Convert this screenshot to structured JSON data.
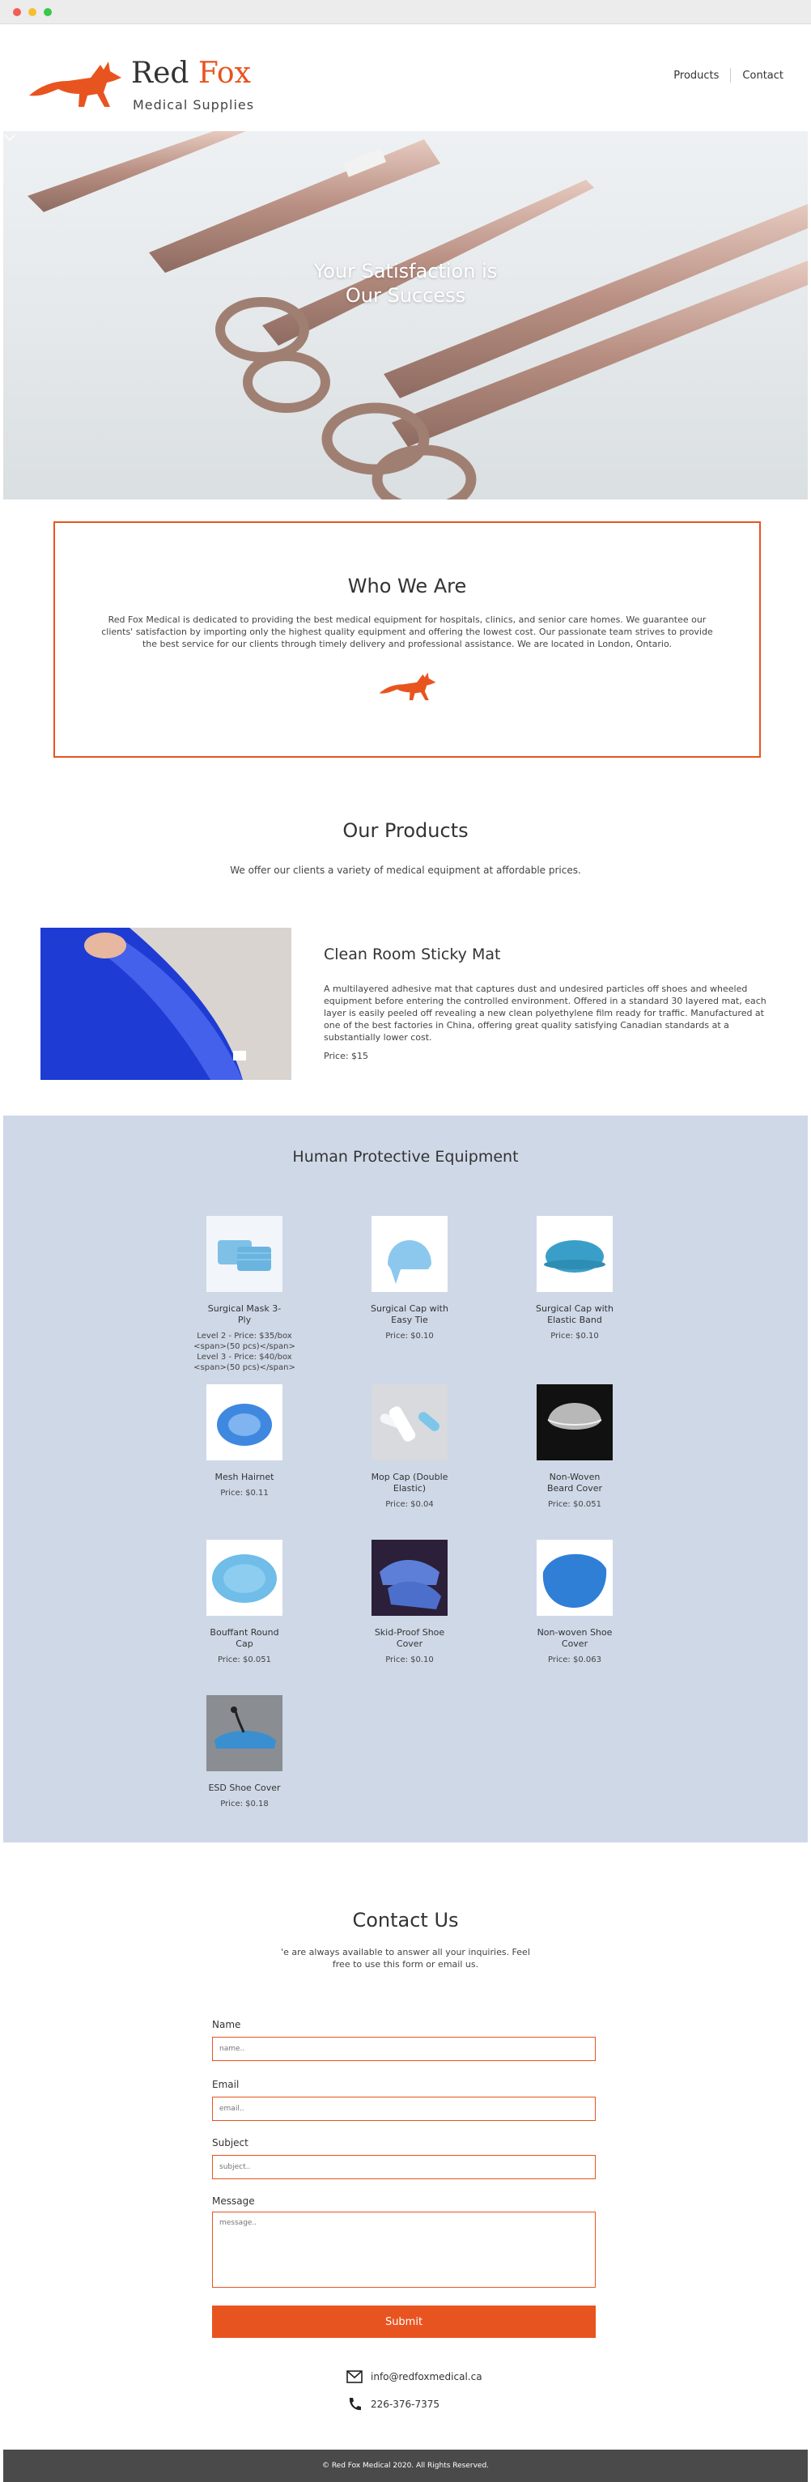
{
  "brand": {
    "name_part1": "Red",
    "name_part2": "Fox",
    "tagline": "Medical Supplies",
    "accent_color": "#e8541f"
  },
  "nav": {
    "items": [
      "Products",
      "Contact"
    ]
  },
  "hero": {
    "title_line1": "Your Satisfaction is",
    "title_line2": "Our Success",
    "icon": "chevron-down-icon"
  },
  "who": {
    "title": "Who We Are",
    "text": "Red Fox Medical is dedicated to providing the best medical equipment for hospitals, clinics, and senior care homes. We guarantee our clients' satisfaction by importing only the highest quality equipment and offering the lowest cost. Our passionate team strives to provide the best service for our clients through timely delivery and professional assistance. We are located in London, Ontario."
  },
  "products": {
    "title": "Our Products",
    "intro": "We offer our clients a variety of medical equipment at affordable prices.",
    "featured": {
      "name": "Clean Room Sticky Mat",
      "description": "A multilayered adhesive mat that captures dust and undesired particles off shoes and wheeled equipment before entering the controlled environment. Offered in a standard 30 layered mat, each layer is easily peeled off revealing a new clean polyethylene film ready for traffic. Manufactured at one of the best factories in China, offering great quality satisfying Canadian standards at a substantially lower cost.",
      "price": "Price: $15"
    }
  },
  "ppe": {
    "title": "Human Protective Equipment",
    "items": [
      {
        "name": "Surgical Mask 3-Ply",
        "price1": "Level 2 - Price: $35/box <span>(50 pcs)</span>",
        "price2": "Level 3 - Price: $40/box <span>(50 pcs)</span>"
      },
      {
        "name": "Surgical Cap with Easy Tie",
        "price1": "Price: $0.10",
        "price2": ""
      },
      {
        "name": "Surgical Cap with Elastic Band",
        "price1": "Price: $0.10",
        "price2": ""
      },
      {
        "name": "Mesh Hairnet",
        "price1": "Price: $0.11",
        "price2": ""
      },
      {
        "name": "Mop Cap (Double Elastic)",
        "price1": "Price: $0.04",
        "price2": ""
      },
      {
        "name": "Non-Woven Beard Cover",
        "price1": "Price: $0.051",
        "price2": ""
      },
      {
        "name": "Bouffant Round Cap",
        "price1": "Price: $0.051",
        "price2": ""
      },
      {
        "name": "Skid-Proof Shoe Cover",
        "price1": "Price: $0.10",
        "price2": ""
      },
      {
        "name": "Non-woven Shoe Cover",
        "price1": "Price: $0.063",
        "price2": ""
      },
      {
        "name": "ESD Shoe Cover",
        "price1": "Price: $0.18",
        "price2": ""
      }
    ]
  },
  "contact": {
    "title": "Contact Us",
    "intro": "'e are always available to answer all your inquiries. Feel free to use this form or email us.",
    "fields": {
      "name_label": "Name",
      "name_placeholder": "name..",
      "email_label": "Email",
      "email_placeholder": "email..",
      "subject_label": "Subject",
      "subject_placeholder": "subject..",
      "message_label": "Message",
      "message_placeholder": "message.."
    },
    "submit": "Submit",
    "email": "info@redfoxmedical.ca",
    "phone": "226-376-7375",
    "email_icon": "envelope-icon",
    "phone_icon": "phone-icon"
  },
  "footer": {
    "text": "© Red Fox Medical 2020. All Rights Reserved."
  }
}
